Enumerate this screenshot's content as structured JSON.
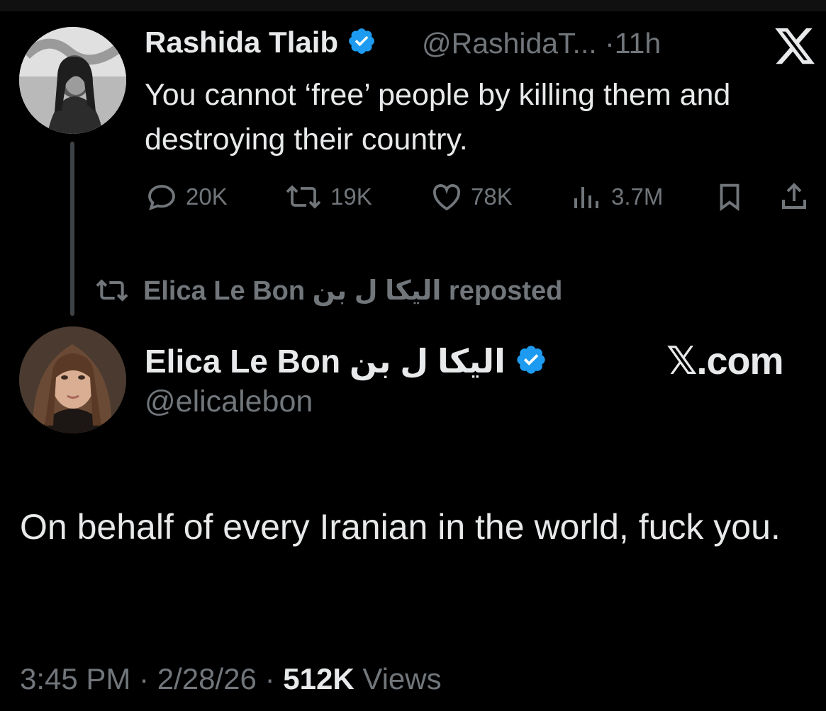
{
  "quoted": {
    "name": "Rashida Tlaib",
    "handle": "@RashidaT...",
    "dot": "·",
    "time": "11h",
    "text": "You cannot ‘free’ people by killing them and destroying their country.",
    "actions": {
      "replies": "20K",
      "reposts": "19K",
      "likes": "78K",
      "views": "3.7M"
    }
  },
  "repost_line": {
    "text": "Elica Le Bon الیکا ل بن reposted"
  },
  "tweet": {
    "name": "Elica Le Bon الیکا ل بن",
    "handle": "@elicalebon",
    "watermark": "𝕏.com",
    "text": "On behalf of every Iranian in the world, fuck you.",
    "time": "3:45 PM",
    "sep1": "·",
    "date": "2/28/26",
    "sep2": "·",
    "views_count": "512K",
    "views_label": "Views"
  },
  "colors": {
    "background": "#000000",
    "primary_text": "#e7e9ea",
    "secondary_text": "#71767b",
    "verified": "#1d9bf0",
    "thread_line": "#3d4246"
  },
  "icons": [
    "verified-badge-icon",
    "x-logo-icon",
    "reply-icon",
    "repost-icon",
    "like-icon",
    "views-icon",
    "bookmark-icon",
    "share-icon"
  ]
}
